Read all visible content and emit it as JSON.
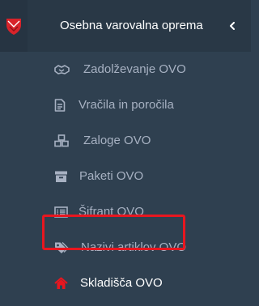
{
  "header": {
    "title": "Osebna varovalna oprema",
    "logo_icon": "shield-logo-icon",
    "collapse_icon": "chevron-left-icon"
  },
  "menu": {
    "items": [
      {
        "label": "Zadolževanje OVO",
        "icon": "handshake-icon",
        "active": false
      },
      {
        "label": "Vračila in poročila",
        "icon": "document-icon",
        "active": false
      },
      {
        "label": "Zaloge OVO",
        "icon": "cubes-icon",
        "active": false
      },
      {
        "label": "Paketi OVO",
        "icon": "archive-icon",
        "active": false
      },
      {
        "label": "Šifrant OVO",
        "icon": "list-icon",
        "active": false
      },
      {
        "label": "Nazivi artiklov OVO",
        "icon": "tags-icon",
        "active": false
      },
      {
        "label": "Skladišča OVO",
        "icon": "home-icon",
        "active": true
      }
    ]
  },
  "colors": {
    "sidebar_bg": "#2f4050",
    "header_bg": "#293846",
    "text_muted": "#a7b1c2",
    "text_active": "#ffffff",
    "home_icon": "#e8161f",
    "highlight_border": "#e8161f",
    "logo_red": "#d8232a"
  }
}
